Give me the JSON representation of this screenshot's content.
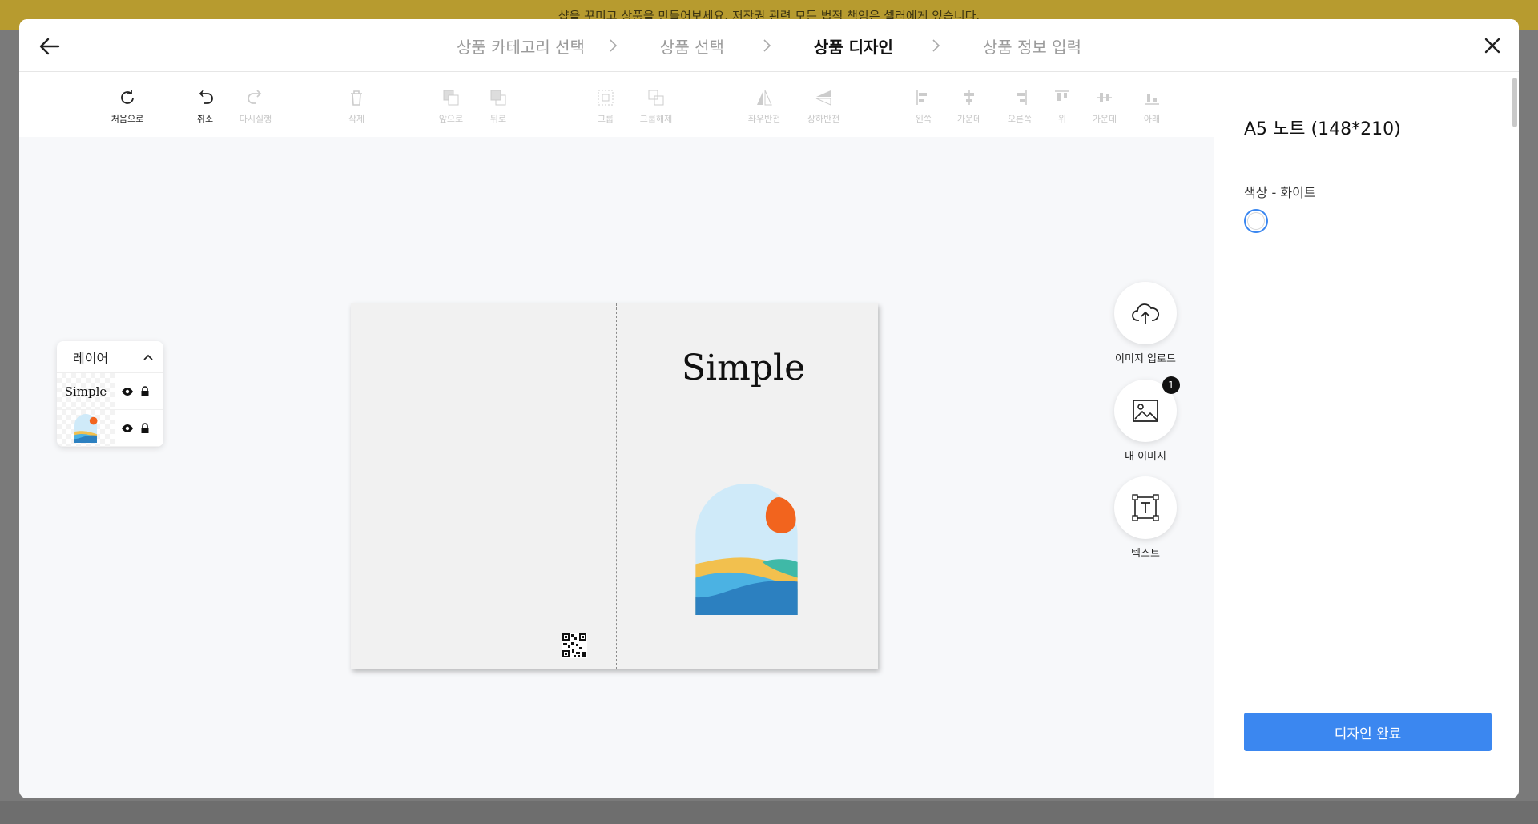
{
  "banner": {
    "text": "샵을 꾸미고 상품을 만들어보세요. 저작권 관련 모든 법적 책임은 셀러에게 있습니다."
  },
  "steps": [
    {
      "label": "상품 카테고리 선택",
      "active": false
    },
    {
      "label": "상품 선택",
      "active": false
    },
    {
      "label": "상품 디자인",
      "active": true
    },
    {
      "label": "상품 정보 입력",
      "active": false
    }
  ],
  "toolbar": {
    "reset": "처음으로",
    "undo": "취소",
    "redo": "다시실행",
    "delete": "삭제",
    "front": "앞으로",
    "back": "뒤로",
    "group": "그룹",
    "ungroup": "그룹해제",
    "flip_h": "좌우반전",
    "flip_v": "상하반전",
    "align_left": "왼쪽",
    "align_center": "가운데",
    "align_right": "오른쪽",
    "align_top": "위",
    "align_middle": "가운데",
    "align_bottom": "아래"
  },
  "layers": {
    "title": "레이어",
    "items": [
      {
        "type": "text",
        "label": "Simple"
      },
      {
        "type": "image",
        "label": ""
      }
    ]
  },
  "canvas": {
    "title_text": "Simple"
  },
  "side_actions": {
    "upload": "이미지 업로드",
    "my_images": "내 이미지",
    "my_images_count": "1",
    "text": "텍스트"
  },
  "panel": {
    "product_name": "A5 노트 (148*210)",
    "color_label": "색상 - 화이트",
    "selected_color": "#ffffff",
    "done_button": "디자인 완료"
  },
  "colors": {
    "accent": "#3b87f0",
    "highlight": "#f6ea1c",
    "banner": "#b79b2f"
  }
}
